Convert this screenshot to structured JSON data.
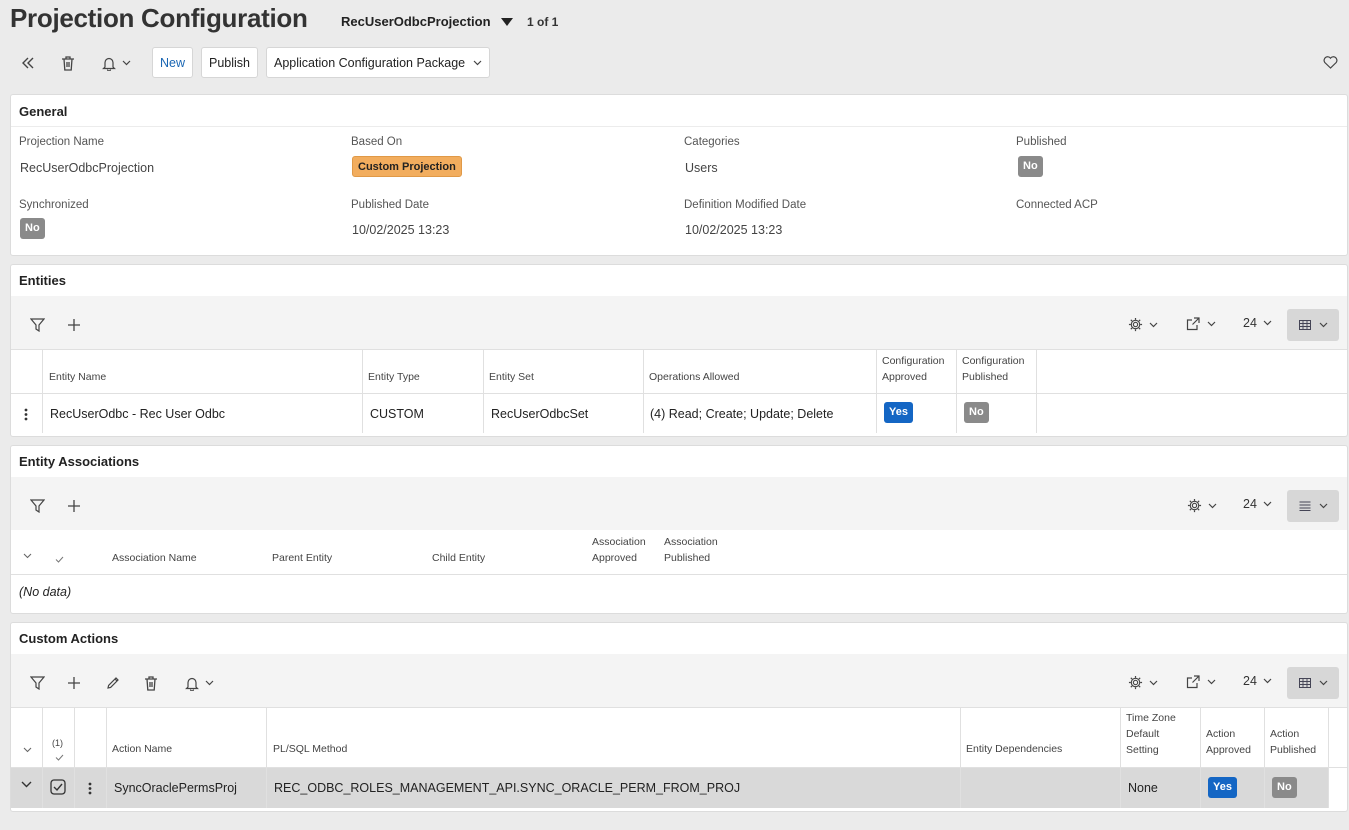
{
  "header": {
    "title": "Projection Configuration",
    "record": "RecUserOdbcProjection",
    "record_count": "1 of 1"
  },
  "toolbar": {
    "new_label": "New",
    "publish_label": "Publish",
    "acp_label": "Application Configuration Package"
  },
  "general": {
    "title": "General",
    "projection_name_label": "Projection Name",
    "projection_name": "RecUserOdbcProjection",
    "based_on_label": "Based On",
    "based_on": "Custom Projection",
    "categories_label": "Categories",
    "categories": "Users",
    "published_label": "Published",
    "published": "No",
    "synchronized_label": "Synchronized",
    "synchronized": "No",
    "published_date_label": "Published Date",
    "published_date": "10/02/2025 13:23",
    "definition_modified_label": "Definition Modified Date",
    "definition_modified": "10/02/2025 13:23",
    "connected_acp_label": "Connected ACP"
  },
  "entities": {
    "title": "Entities",
    "page_size": "24",
    "columns": {
      "entity_name": "Entity Name",
      "entity_type": "Entity Type",
      "entity_set": "Entity Set",
      "operations": "Operations Allowed",
      "config_approved_1": "Configuration",
      "config_approved_2": "Approved",
      "config_published_1": "Configuration",
      "config_published_2": "Published"
    },
    "row": {
      "entity_name": "RecUserOdbc - Rec User Odbc",
      "entity_type": "CUSTOM",
      "entity_set": "RecUserOdbcSet",
      "operations": "(4) Read; Create; Update; Delete",
      "config_approved": "Yes",
      "config_published": "No"
    }
  },
  "associations": {
    "title": "Entity Associations",
    "page_size": "24",
    "columns": {
      "association_name": "Association Name",
      "parent_entity": "Parent Entity",
      "child_entity": "Child Entity",
      "approved_1": "Association",
      "approved_2": "Approved",
      "published_1": "Association",
      "published_2": "Published"
    },
    "no_data": "(No data)"
  },
  "custom_actions": {
    "title": "Custom Actions",
    "page_size": "24",
    "selected_count": "(1)",
    "columns": {
      "action_name": "Action Name",
      "plsql_method": "PL/SQL Method",
      "entity_dependencies": "Entity Dependencies",
      "tz_1": "Time Zone",
      "tz_2": "Default",
      "tz_3": "Setting",
      "approved_1": "Action",
      "approved_2": "Approved",
      "published_1": "Action",
      "published_2": "Published"
    },
    "row": {
      "action_name": "SyncOraclePermsProj",
      "plsql_method": "REC_ODBC_ROLES_MANAGEMENT_API.SYNC_ORACLE_PERM_FROM_PROJ",
      "time_zone": "None",
      "approved": "Yes",
      "published": "No"
    }
  }
}
